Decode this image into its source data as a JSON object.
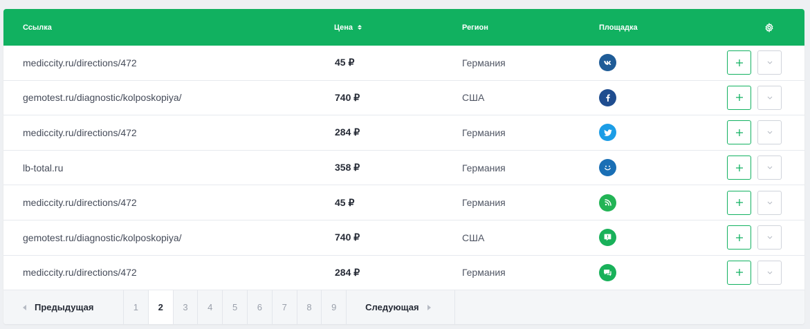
{
  "table": {
    "columns": {
      "link": "Ссылка",
      "price": "Цена",
      "region": "Регион",
      "platform": "Площадка"
    },
    "rows": [
      {
        "link": "mediccity.ru/directions/472",
        "price": "45 ₽",
        "region": "Германия",
        "platform": "vk-icon",
        "color": "#1f5c97"
      },
      {
        "link": "gemotest.ru/diagnostic/kolposkopiya/",
        "price": "740 ₽",
        "region": "США",
        "platform": "facebook-icon",
        "color": "#1f4d8f"
      },
      {
        "link": "mediccity.ru/directions/472",
        "price": "284 ₽",
        "region": "Германия",
        "platform": "twitter-icon",
        "color": "#1c9de6"
      },
      {
        "link": "lb-total.ru",
        "price": "358 ₽",
        "region": "Германия",
        "platform": "smile-icon",
        "color": "#1a6fb5"
      },
      {
        "link": "mediccity.ru/directions/472",
        "price": "45 ₽",
        "region": "Германия",
        "platform": "rss-icon",
        "color": "#22b455"
      },
      {
        "link": "gemotest.ru/diagnostic/kolposkopiya/",
        "price": "740 ₽",
        "region": "США",
        "platform": "chat-icon",
        "color": "#19b15a"
      },
      {
        "link": "mediccity.ru/directions/472",
        "price": "284 ₽",
        "region": "Германия",
        "platform": "message-icon",
        "color": "#19b15a"
      }
    ]
  },
  "pager": {
    "prev": "Предыдущая",
    "next": "Следующая",
    "pages": [
      "1",
      "2",
      "3",
      "4",
      "5",
      "6",
      "7",
      "8",
      "9"
    ],
    "active": "2"
  },
  "colors": {
    "accent": "#11b160"
  }
}
